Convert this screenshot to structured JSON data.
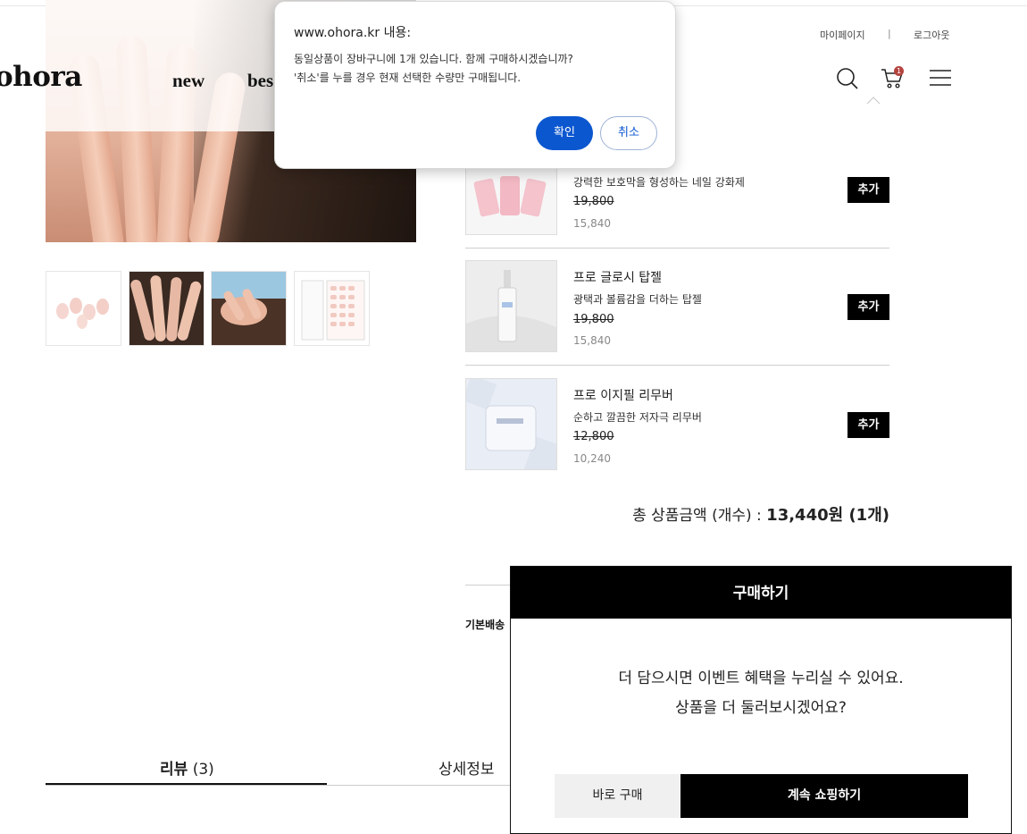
{
  "header": {
    "logo": "ohora",
    "nav": [
      "new",
      "bes"
    ],
    "util_links": [
      "마이페이지",
      "|",
      "로그아웃"
    ],
    "cart_count": "1",
    "icons": [
      "search-icon",
      "cart-icon",
      "menu-icon"
    ]
  },
  "products": [
    {
      "name": "",
      "desc": "강력한 보호막을 형성하는 네일 강화제",
      "orig": "19,800",
      "sale": "15,840",
      "add": "추가"
    },
    {
      "name": "프로 글로시 탑젤",
      "desc": "광택과 볼륨감을 더하는 탑젤",
      "orig": "19,800",
      "sale": "15,840",
      "add": "추가"
    },
    {
      "name": "프로 이지필 리무버",
      "desc": "순하고 깔끔한 저자극 리무버",
      "orig": "12,800",
      "sale": "10,240",
      "add": "추가"
    }
  ],
  "total": {
    "label": "총 상품금액 (개수) : ",
    "amount": "13,440원 (1개)"
  },
  "shipping_label": "기본배송",
  "tabs": {
    "review": "리뷰",
    "review_count": "(3)",
    "detail": "상세정보"
  },
  "buy_modal": {
    "title": "구매하기",
    "line1": "더 담으시면 이벤트 혜택을 누리실 수 있어요.",
    "line2": "상품을 더 둘러보시겠어요?",
    "direct": "바로 구매",
    "continue": "계속 쇼핑하기"
  },
  "confirm_dialog": {
    "title": "www.ohora.kr 내용:",
    "line1": "동일상품이 장바구니에 1개 있습니다. 함께 구매하시겠습니까?",
    "line2": "'취소'를 누를 경우 현재 선택한 수량만 구매됩니다.",
    "ok": "확인",
    "cancel": "취소"
  },
  "colors": {
    "dialog_accent": "#0b57d0",
    "badge": "#b5443f",
    "primary": "#000000"
  }
}
